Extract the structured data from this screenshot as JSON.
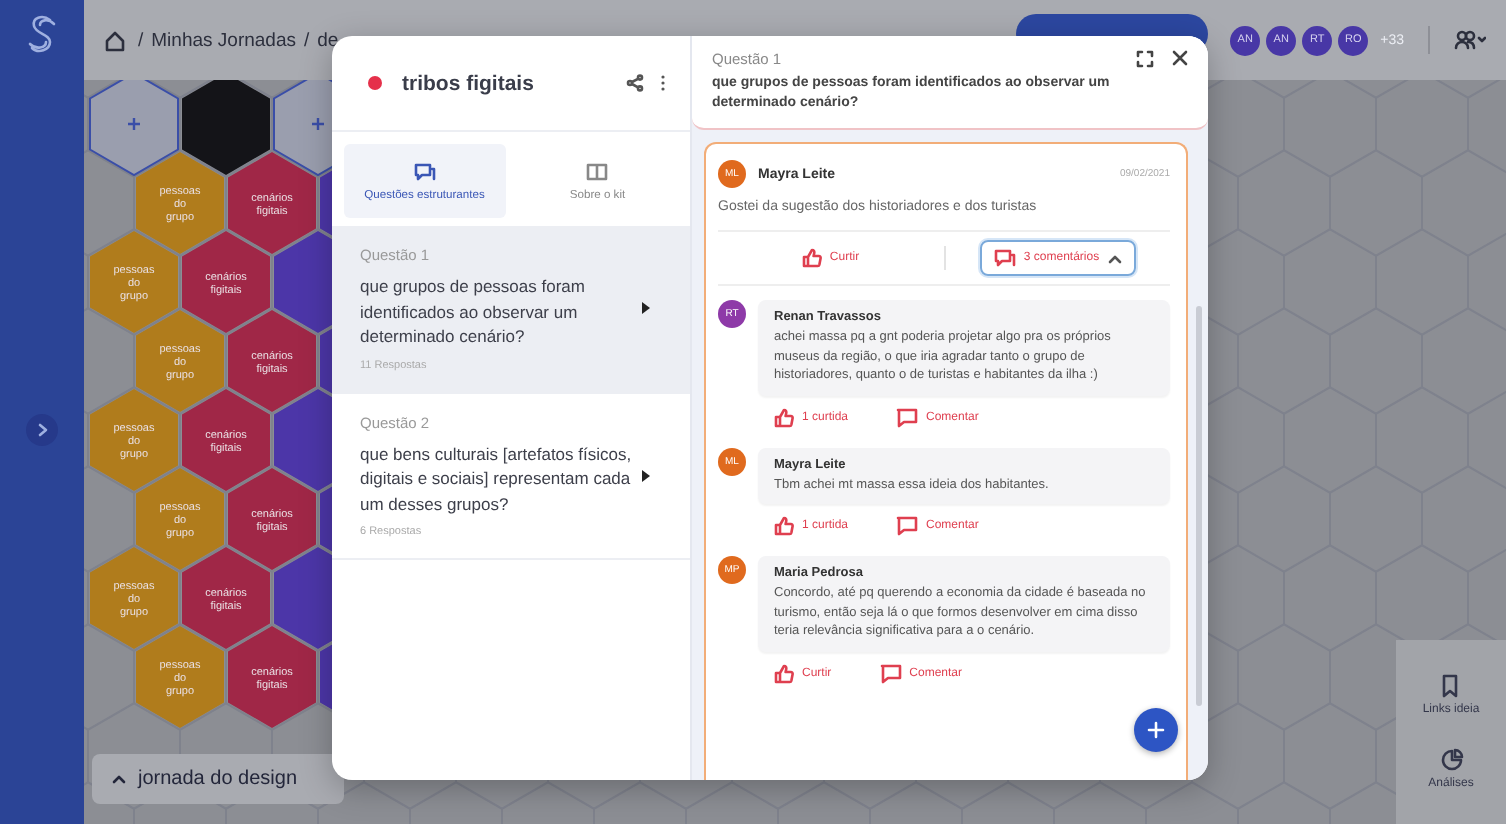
{
  "breadcrumb": [
    {
      "separator": "/",
      "label": "Minhas Jornadas"
    },
    {
      "separator": "/",
      "label": "de"
    }
  ],
  "collaborators": [
    {
      "initials": "AN"
    },
    {
      "initials": "AN"
    },
    {
      "initials": "RT"
    },
    {
      "initials": "RO"
    }
  ],
  "collaborators_more": "+33",
  "canvas": {
    "rows": [
      [
        {
          "kind": "add"
        },
        {
          "kind": "tile",
          "color": "#141418"
        },
        {
          "kind": "add"
        }
      ],
      [
        {
          "kind": "tile",
          "color": "#b07c1c",
          "label": "pessoas do grupo"
        },
        {
          "kind": "tile",
          "color": "#a02747",
          "label": "cenários figitais"
        },
        {
          "kind": "tile",
          "color": "#4c36a8"
        }
      ],
      [
        {
          "kind": "tile",
          "color": "#b07c1c",
          "label": "pessoas do grupo"
        },
        {
          "kind": "tile",
          "color": "#a02747",
          "label": "cenários figitais"
        },
        {
          "kind": "tile",
          "color": "#4c36a8"
        }
      ],
      [
        {
          "kind": "tile",
          "color": "#b07c1c",
          "label": "pessoas do grupo"
        },
        {
          "kind": "tile",
          "color": "#a02747",
          "label": "cenários figitais"
        },
        {
          "kind": "tile",
          "color": "#4c36a8"
        }
      ],
      [
        {
          "kind": "tile",
          "color": "#b07c1c",
          "label": "pessoas do grupo"
        },
        {
          "kind": "tile",
          "color": "#a02747",
          "label": "cenários figitais"
        },
        {
          "kind": "tile",
          "color": "#4c36a8"
        }
      ],
      [
        {
          "kind": "tile",
          "color": "#b07c1c",
          "label": "pessoas do grupo"
        },
        {
          "kind": "tile",
          "color": "#a02747",
          "label": "cenários figitais"
        },
        {
          "kind": "tile",
          "color": "#4c36a8"
        }
      ],
      [
        {
          "kind": "tile",
          "color": "#b07c1c",
          "label": "pessoas do grupo"
        },
        {
          "kind": "tile",
          "color": "#a02747",
          "label": "cenários figitais"
        },
        {
          "kind": "tile",
          "color": "#4c36a8"
        }
      ],
      [
        {
          "kind": "tile",
          "color": "#b07c1c",
          "label": "pessoas do grupo"
        },
        {
          "kind": "tile",
          "color": "#a02747",
          "label": "cenários figitais"
        },
        {
          "kind": "tile",
          "color": "#4c36a8"
        }
      ]
    ]
  },
  "journey": {
    "label": "jornada do design"
  },
  "tools": [
    {
      "kind": "bookmark",
      "label": "Links ideia"
    },
    {
      "kind": "chart",
      "label": "Análises"
    }
  ],
  "modal": {
    "kit": {
      "title": "tribos figitais",
      "color": "#e5304a"
    },
    "tabs": [
      {
        "kind": "chat",
        "label": "Questões estruturantes",
        "selected": true
      },
      {
        "kind": "book",
        "label": "Sobre o kit",
        "selected": false
      }
    ],
    "questions": [
      {
        "number": "Questão 1",
        "text": "que grupos de pessoas foram identificados ao observar um determinado cenário?",
        "answers": "11 Respostas",
        "selected": true
      },
      {
        "number": "Questão 2",
        "text": "que bens culturais [artefatos físicos, digitais e sociais] representam cada um desses grupos?",
        "answers": "6 Respostas",
        "selected": false
      }
    ],
    "thread": {
      "question_number": "Questão 1",
      "question": "que grupos de pessoas foram identificados ao observar um determinado cenário?",
      "comment": {
        "initials": "ML",
        "color": "#e06a1e",
        "author": "Mayra Leite",
        "date": "09/02/2021",
        "text": "Gostei da sugestão dos historiadores e dos turistas",
        "like": "Curtir",
        "comments": "3 comentários",
        "expanded": true
      },
      "replies": [
        {
          "initials": "RT",
          "color": "#8e3aa8",
          "author": "Renan Travassos",
          "text": "achei massa pq a gnt poderia projetar algo pra os próprios museus da região, o que iria agradar tanto o grupo de historiadores, quanto o de turistas e habitantes da ilha :)",
          "like": "1 curtida",
          "reply": "Comentar"
        },
        {
          "initials": "ML",
          "color": "#e06a1e",
          "author": "Mayra Leite",
          "text": "Tbm achei mt massa essa ideia dos habitantes.",
          "like": "1 curtida",
          "reply": "Comentar"
        },
        {
          "initials": "MP",
          "color": "#e06a1e",
          "author": "Maria Pedrosa",
          "text": "Concordo, até pq querendo a economia da cidade é baseada no turismo, então seja lá o que formos desenvolver em cima disso teria relevância significativa para a o cenário.",
          "like": "Curtir",
          "reply": "Comentar"
        }
      ]
    }
  }
}
